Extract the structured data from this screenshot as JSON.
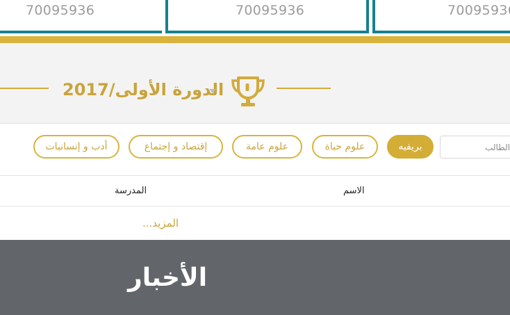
{
  "top_cards": [
    {
      "number": "70095936"
    },
    {
      "number": "70095936"
    },
    {
      "number": "70095936"
    }
  ],
  "session": {
    "title": "الدورة الأولى/2017"
  },
  "filters": {
    "search_placeholder": "الطالب",
    "tabs": [
      {
        "label": "بريفيه",
        "active": true
      },
      {
        "label": "علوم حياة",
        "active": false
      },
      {
        "label": "علوم عامة",
        "active": false
      },
      {
        "label": "إقتصاد و إجتماع",
        "active": false
      },
      {
        "label": "أدب و إنسانيات",
        "active": false
      }
    ]
  },
  "table": {
    "columns": {
      "name": "الاسم",
      "school": "المدرسة"
    },
    "more_label": "المزيد..."
  },
  "news": {
    "title": "الأخبار"
  },
  "colors": {
    "gold": "#d4ad37",
    "teal": "#16808f",
    "news_bg": "#62666a"
  }
}
